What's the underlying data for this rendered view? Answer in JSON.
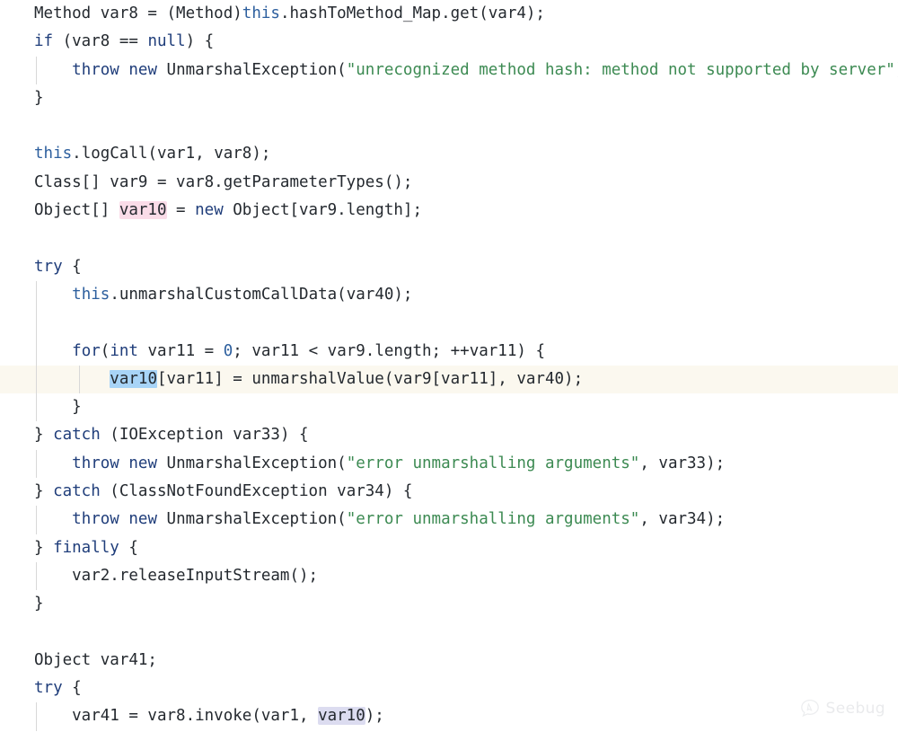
{
  "viewer": {
    "language": "java",
    "watermark": {
      "text": "Seebug",
      "logo_icon": "seebug-speech-bubble-icon"
    },
    "colors": {
      "background": "#ffffff",
      "foreground": "#24292f",
      "keyword": "#1f3d7a",
      "this_keyword": "#2d5f9e",
      "number": "#2d5f9e",
      "string": "#3c8a52",
      "indent_guide": "#d8d8d8",
      "active_line_background": "#fbf8ef",
      "highlight_pink": "#fadce8",
      "highlight_blue_selection": "#a8d4f7",
      "highlight_lavender": "#dcdcf0"
    }
  },
  "code": {
    "lines": [
      {
        "id": 1,
        "highlighted": false,
        "guides": [],
        "tokens": [
          {
            "text": "Method var8 = (Method)",
            "kind": "plain"
          },
          {
            "text": "this",
            "kind": "this"
          },
          {
            "text": ".hashToMethod_Map.get(var4);",
            "kind": "plain"
          }
        ]
      },
      {
        "id": 2,
        "highlighted": false,
        "guides": [],
        "tokens": [
          {
            "text": "if",
            "kind": "kw"
          },
          {
            "text": " (var8 == ",
            "kind": "plain"
          },
          {
            "text": "null",
            "kind": "kw"
          },
          {
            "text": ") {",
            "kind": "plain"
          }
        ]
      },
      {
        "id": 3,
        "highlighted": false,
        "guides": [
          "g1"
        ],
        "tokens": [
          {
            "text": "    ",
            "kind": "plain"
          },
          {
            "text": "throw",
            "kind": "kw"
          },
          {
            "text": " ",
            "kind": "plain"
          },
          {
            "text": "new",
            "kind": "kw"
          },
          {
            "text": " UnmarshalException(",
            "kind": "plain"
          },
          {
            "text": "\"unrecognized method hash: method not supported by server\"",
            "kind": "str"
          },
          {
            "text": ");",
            "kind": "plain"
          }
        ]
      },
      {
        "id": 4,
        "highlighted": false,
        "guides": [],
        "tokens": [
          {
            "text": "}",
            "kind": "plain"
          }
        ]
      },
      {
        "id": 5,
        "highlighted": false,
        "guides": [],
        "tokens": []
      },
      {
        "id": 6,
        "highlighted": false,
        "guides": [],
        "tokens": [
          {
            "text": "this",
            "kind": "this"
          },
          {
            "text": ".logCall(var1, var8);",
            "kind": "plain"
          }
        ]
      },
      {
        "id": 7,
        "highlighted": false,
        "guides": [],
        "tokens": [
          {
            "text": "Class[] var9 = var8.getParameterTypes();",
            "kind": "plain"
          }
        ]
      },
      {
        "id": 8,
        "highlighted": false,
        "guides": [],
        "tokens": [
          {
            "text": "Object[] ",
            "kind": "plain"
          },
          {
            "text": "var10",
            "kind": "plain",
            "highlight": "pink"
          },
          {
            "text": " = ",
            "kind": "plain"
          },
          {
            "text": "new",
            "kind": "kw"
          },
          {
            "text": " Object[var9.length];",
            "kind": "plain"
          }
        ]
      },
      {
        "id": 9,
        "highlighted": false,
        "guides": [],
        "tokens": []
      },
      {
        "id": 10,
        "highlighted": false,
        "guides": [],
        "tokens": [
          {
            "text": "try",
            "kind": "kw"
          },
          {
            "text": " {",
            "kind": "plain"
          }
        ]
      },
      {
        "id": 11,
        "highlighted": false,
        "guides": [
          "g1"
        ],
        "tokens": [
          {
            "text": "    ",
            "kind": "plain"
          },
          {
            "text": "this",
            "kind": "this"
          },
          {
            "text": ".unmarshalCustomCallData(var40);",
            "kind": "plain"
          }
        ]
      },
      {
        "id": 12,
        "highlighted": false,
        "guides": [
          "g1"
        ],
        "tokens": []
      },
      {
        "id": 13,
        "highlighted": false,
        "guides": [
          "g1"
        ],
        "tokens": [
          {
            "text": "    ",
            "kind": "plain"
          },
          {
            "text": "for",
            "kind": "kw"
          },
          {
            "text": "(",
            "kind": "plain"
          },
          {
            "text": "int",
            "kind": "kw"
          },
          {
            "text": " var11 = ",
            "kind": "plain"
          },
          {
            "text": "0",
            "kind": "num"
          },
          {
            "text": "; var11 < var9.length; ++var11) {",
            "kind": "plain"
          }
        ]
      },
      {
        "id": 14,
        "highlighted": true,
        "guides": [
          "g1",
          "g2"
        ],
        "tokens": [
          {
            "text": "        ",
            "kind": "plain"
          },
          {
            "text": "var10",
            "kind": "plain",
            "highlight": "blue"
          },
          {
            "text": "[var11] = unmarshalValue(var9[var11], var40);",
            "kind": "plain"
          }
        ]
      },
      {
        "id": 15,
        "highlighted": false,
        "guides": [
          "g1"
        ],
        "tokens": [
          {
            "text": "    }",
            "kind": "plain"
          }
        ]
      },
      {
        "id": 16,
        "highlighted": false,
        "guides": [],
        "tokens": [
          {
            "text": "} ",
            "kind": "plain"
          },
          {
            "text": "catch",
            "kind": "kw"
          },
          {
            "text": " (IOException var33) {",
            "kind": "plain"
          }
        ]
      },
      {
        "id": 17,
        "highlighted": false,
        "guides": [
          "g1"
        ],
        "tokens": [
          {
            "text": "    ",
            "kind": "plain"
          },
          {
            "text": "throw",
            "kind": "kw"
          },
          {
            "text": " ",
            "kind": "plain"
          },
          {
            "text": "new",
            "kind": "kw"
          },
          {
            "text": " UnmarshalException(",
            "kind": "plain"
          },
          {
            "text": "\"error unmarshalling arguments\"",
            "kind": "str"
          },
          {
            "text": ", var33);",
            "kind": "plain"
          }
        ]
      },
      {
        "id": 18,
        "highlighted": false,
        "guides": [],
        "tokens": [
          {
            "text": "} ",
            "kind": "plain"
          },
          {
            "text": "catch",
            "kind": "kw"
          },
          {
            "text": " (ClassNotFoundException var34) {",
            "kind": "plain"
          }
        ]
      },
      {
        "id": 19,
        "highlighted": false,
        "guides": [
          "g1"
        ],
        "tokens": [
          {
            "text": "    ",
            "kind": "plain"
          },
          {
            "text": "throw",
            "kind": "kw"
          },
          {
            "text": " ",
            "kind": "plain"
          },
          {
            "text": "new",
            "kind": "kw"
          },
          {
            "text": " UnmarshalException(",
            "kind": "plain"
          },
          {
            "text": "\"error unmarshalling arguments\"",
            "kind": "str"
          },
          {
            "text": ", var34);",
            "kind": "plain"
          }
        ]
      },
      {
        "id": 20,
        "highlighted": false,
        "guides": [],
        "tokens": [
          {
            "text": "} ",
            "kind": "plain"
          },
          {
            "text": "finally",
            "kind": "kw"
          },
          {
            "text": " {",
            "kind": "plain"
          }
        ]
      },
      {
        "id": 21,
        "highlighted": false,
        "guides": [
          "g1"
        ],
        "tokens": [
          {
            "text": "    var2.releaseInputStream();",
            "kind": "plain"
          }
        ]
      },
      {
        "id": 22,
        "highlighted": false,
        "guides": [],
        "tokens": [
          {
            "text": "}",
            "kind": "plain"
          }
        ]
      },
      {
        "id": 23,
        "highlighted": false,
        "guides": [],
        "tokens": []
      },
      {
        "id": 24,
        "highlighted": false,
        "guides": [],
        "tokens": [
          {
            "text": "Object var41;",
            "kind": "plain"
          }
        ]
      },
      {
        "id": 25,
        "highlighted": false,
        "guides": [],
        "tokens": [
          {
            "text": "try",
            "kind": "kw"
          },
          {
            "text": " {",
            "kind": "plain"
          }
        ]
      },
      {
        "id": 26,
        "highlighted": false,
        "guides": [
          "g1"
        ],
        "tokens": [
          {
            "text": "    var41 = var8.invoke(var1, ",
            "kind": "plain"
          },
          {
            "text": "var10",
            "kind": "plain",
            "highlight": "lavender"
          },
          {
            "text": ");",
            "kind": "plain"
          }
        ]
      }
    ]
  }
}
